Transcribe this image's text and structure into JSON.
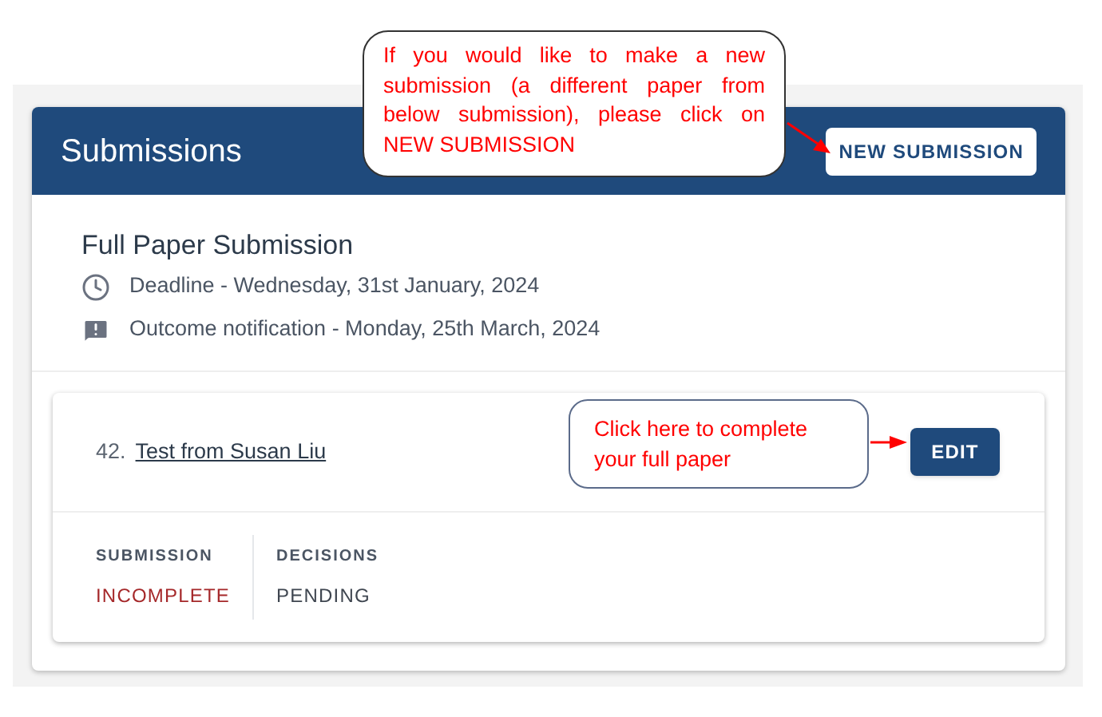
{
  "header": {
    "title": "Submissions",
    "button": "NEW SUBMISSION"
  },
  "section": {
    "title": "Full Paper Submission",
    "dates": [
      {
        "kind": "clock",
        "text": "Deadline - Wednesday, 31st January, 2024"
      },
      {
        "kind": "alert",
        "text": "Outcome notification - Monday, 25th March, 2024"
      }
    ]
  },
  "submission": {
    "number": "42.",
    "title": "Test from Susan Liu",
    "button": "EDIT",
    "stats": [
      {
        "label": "SUBMISSION",
        "value": "INCOMPLETE",
        "color": "#a5282a"
      },
      {
        "label": "DECISIONS",
        "value": "PENDING",
        "color": "#3f4650"
      }
    ]
  },
  "annotations": {
    "new_submission_note": "If you would like to make a new submission (a different paper from below submission), please click on NEW SUBMISSION",
    "edit_note": "Click here to complete your full paper"
  }
}
